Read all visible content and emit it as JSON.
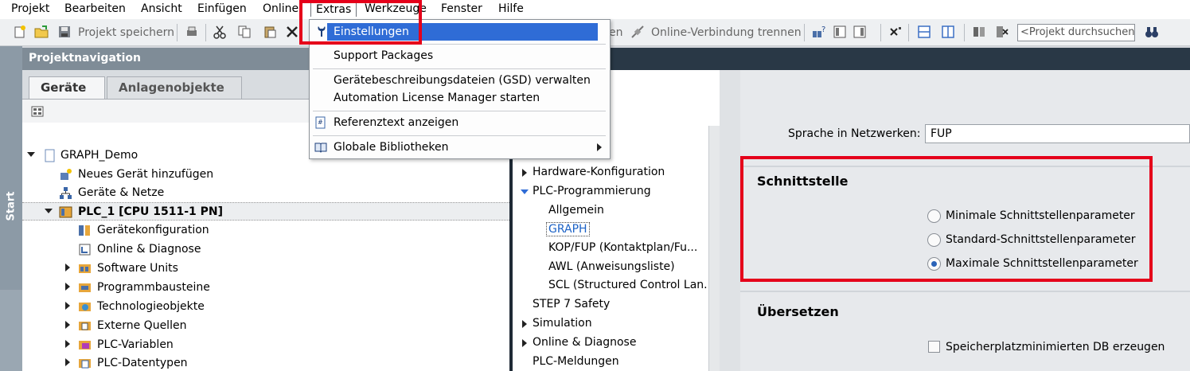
{
  "menubar": {
    "items": [
      "Projekt",
      "Bearbeiten",
      "Ansicht",
      "Einfügen",
      "Online",
      "Extras",
      "Werkzeuge",
      "Fenster",
      "Hilfe"
    ]
  },
  "toolbar": {
    "save_label": "Projekt speichern",
    "online_partial": "en",
    "disconnect_label": "Online-Verbindung trennen",
    "search_placeholder": "<Projekt durchsuchen>"
  },
  "startbar": {
    "label": "Start"
  },
  "project_nav": {
    "title": "Projektnavigation",
    "tabs": [
      "Geräte",
      "Anlagenobjekte"
    ],
    "tree": [
      {
        "label": "GRAPH_Demo",
        "icon": "project-icon"
      },
      {
        "label": "Neues Gerät hinzufügen",
        "icon": "add-device-icon"
      },
      {
        "label": "Geräte & Netze",
        "icon": "network-icon"
      },
      {
        "label": "PLC_1 [CPU 1511-1 PN]",
        "icon": "plc-icon"
      },
      {
        "label": "Gerätekonfiguration",
        "icon": "device-config-icon"
      },
      {
        "label": "Online & Diagnose",
        "icon": "online-diagnose-icon"
      },
      {
        "label": "Software Units",
        "icon": "software-units-icon"
      },
      {
        "label": "Programmbausteine",
        "icon": "program-blocks-icon"
      },
      {
        "label": "Technologieobjekte",
        "icon": "technology-objects-icon"
      },
      {
        "label": "Externe Quellen",
        "icon": "external-sources-icon"
      },
      {
        "label": "PLC-Variablen",
        "icon": "plc-tags-icon"
      },
      {
        "label": "PLC-Datentypen",
        "icon": "plc-datatypes-icon"
      }
    ]
  },
  "extras_menu": {
    "items": [
      {
        "label": "Einstellungen",
        "icon": "settings-wrench-icon"
      },
      {
        "label": "Support Packages"
      },
      {
        "label": "Gerätebeschreibungsdateien (GSD) verwalten"
      },
      {
        "label": "Automation License Manager starten"
      },
      {
        "label": "Referenztext anzeigen",
        "icon": "reference-text-icon"
      },
      {
        "label": "Globale Bibliotheken",
        "icon": "library-icon"
      }
    ]
  },
  "settings_tree": {
    "items": [
      "Hardware-Konfiguration",
      "PLC-Programmierung",
      "Allgemein",
      "GRAPH",
      "KOP/FUP (Kontaktplan/Fu...",
      "AWL (Anweisungsliste)",
      "SCL (Structured Control Lan...",
      "STEP 7 Safety",
      "Simulation",
      "Online & Diagnose",
      "PLC-Meldungen"
    ]
  },
  "settings_content": {
    "language_label": "Sprache in Netzwerken:",
    "language_value": "FUP",
    "interface_title": "Schnittstelle",
    "radio_options": [
      "Minimale Schnittstellenparameter",
      "Standard-Schnittstellenparameter",
      "Maximale Schnittstellenparameter"
    ],
    "selected_option_index": 2,
    "compile_title": "Übersetzen",
    "checkbox_label": "Speicherplatzminimierten DB erzeugen"
  },
  "colors": {
    "highlight_red": "#e5001a",
    "menu_selection": "#2f6cd6",
    "selected_tree_text": "#1c62c6"
  }
}
